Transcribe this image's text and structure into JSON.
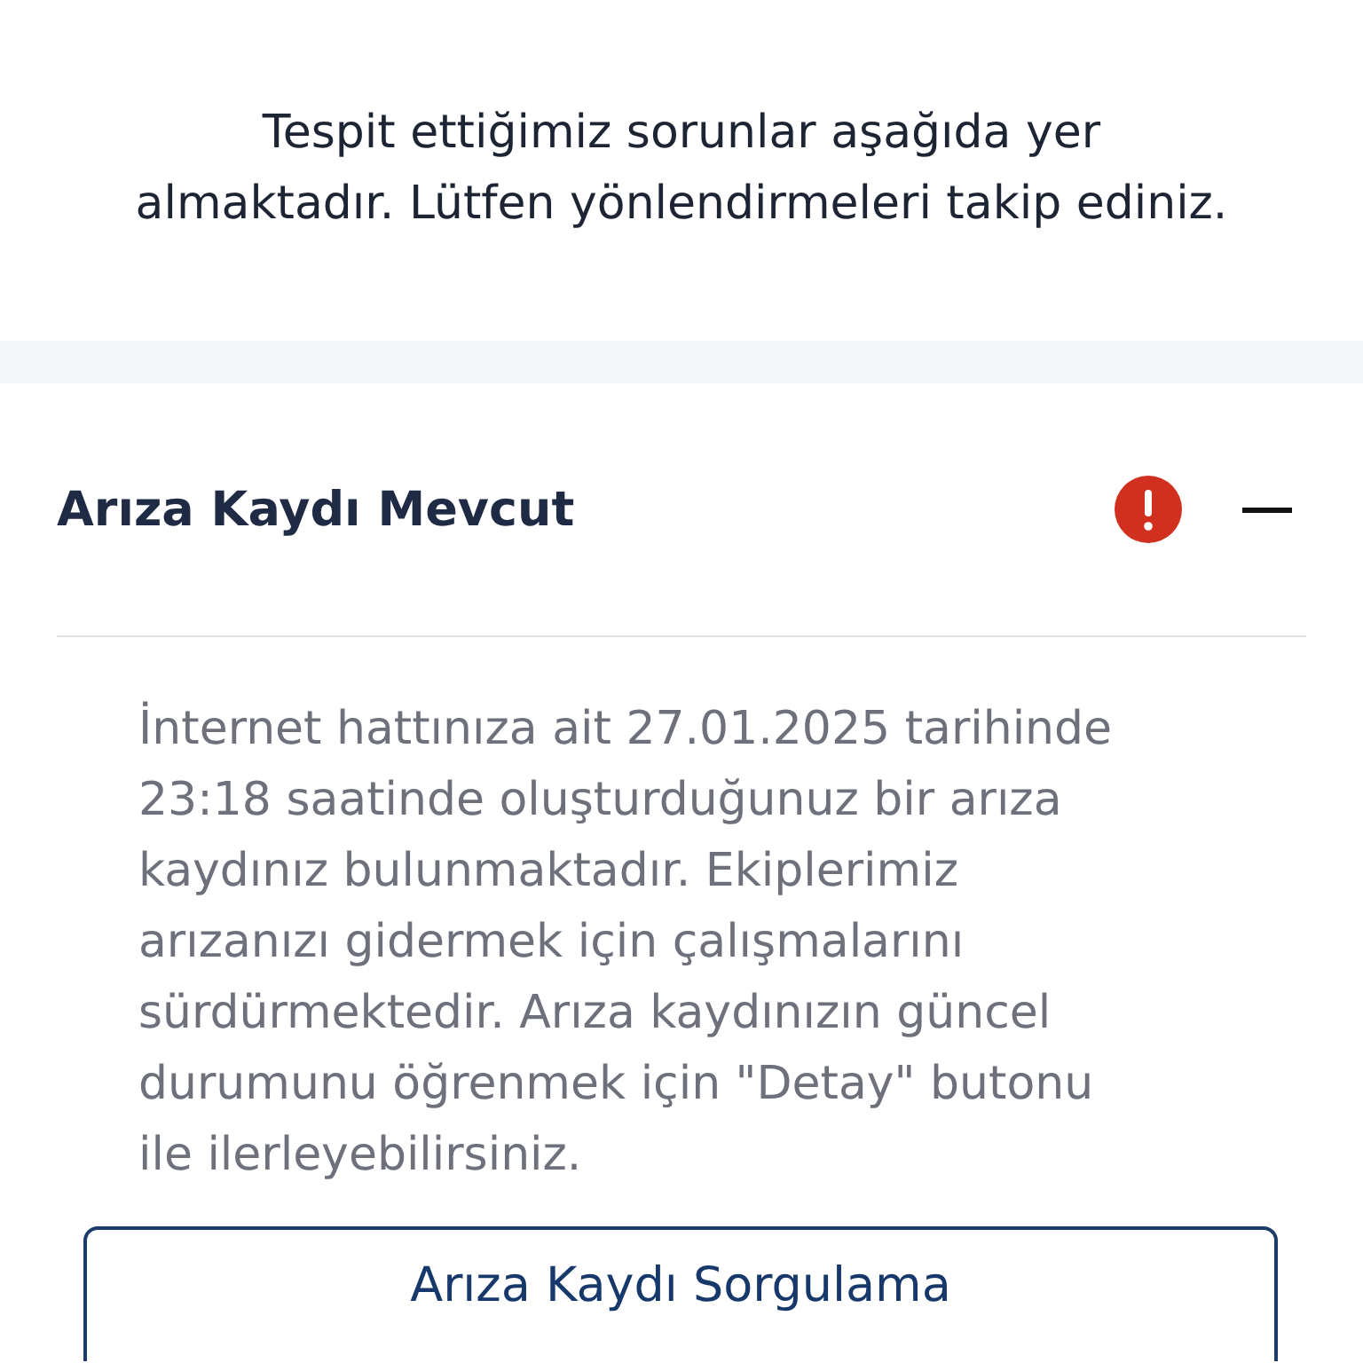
{
  "intro": "Tespit ettiğimiz sorunlar aşağıda yer\nalmaktadır. Lütfen yönlendirmeleri takip ediniz.",
  "issues": [
    {
      "title": "Arıza Kaydı Mevcut",
      "alert": true,
      "expanded": true,
      "description": "İnternet hattınıza ait 27.01.2025 tarihinde\n23:18 saatinde oluşturduğunuz bir arıza\nkaydınız bulunmaktadır. Ekiplerimiz\narızanızı gidermek için çalışmalarını\nsürdürmektedir. Arıza kaydınızın güncel\ndurumunu öğrenmek için \"Detay\" butonu\nile ilerleyebilirsiniz.",
      "button": "Arıza Kaydı Sorgulama"
    }
  ]
}
